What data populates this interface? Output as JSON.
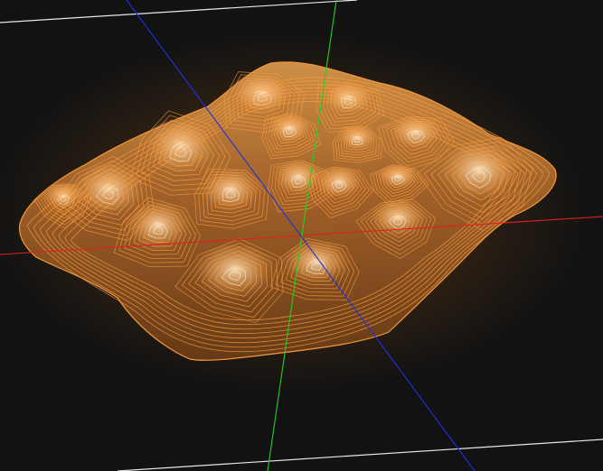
{
  "viewport": {
    "background": "#121212",
    "name": ""
  },
  "scene": {
    "surface_fill": "#b8722a",
    "surface_highlight": "#f2c389",
    "surface_shadow": "#5a3412",
    "glow_color": "#ff8a1e",
    "contour_color": "#ffa040",
    "contour_highlight": "#ffd9a8",
    "plane_edge_color": "#e8e8e8"
  },
  "axes": [
    {
      "name": "x-axis",
      "color": "#e02020"
    },
    {
      "name": "y-axis",
      "color": "#20d020"
    },
    {
      "name": "z-axis",
      "color": "#2030e0"
    }
  ]
}
